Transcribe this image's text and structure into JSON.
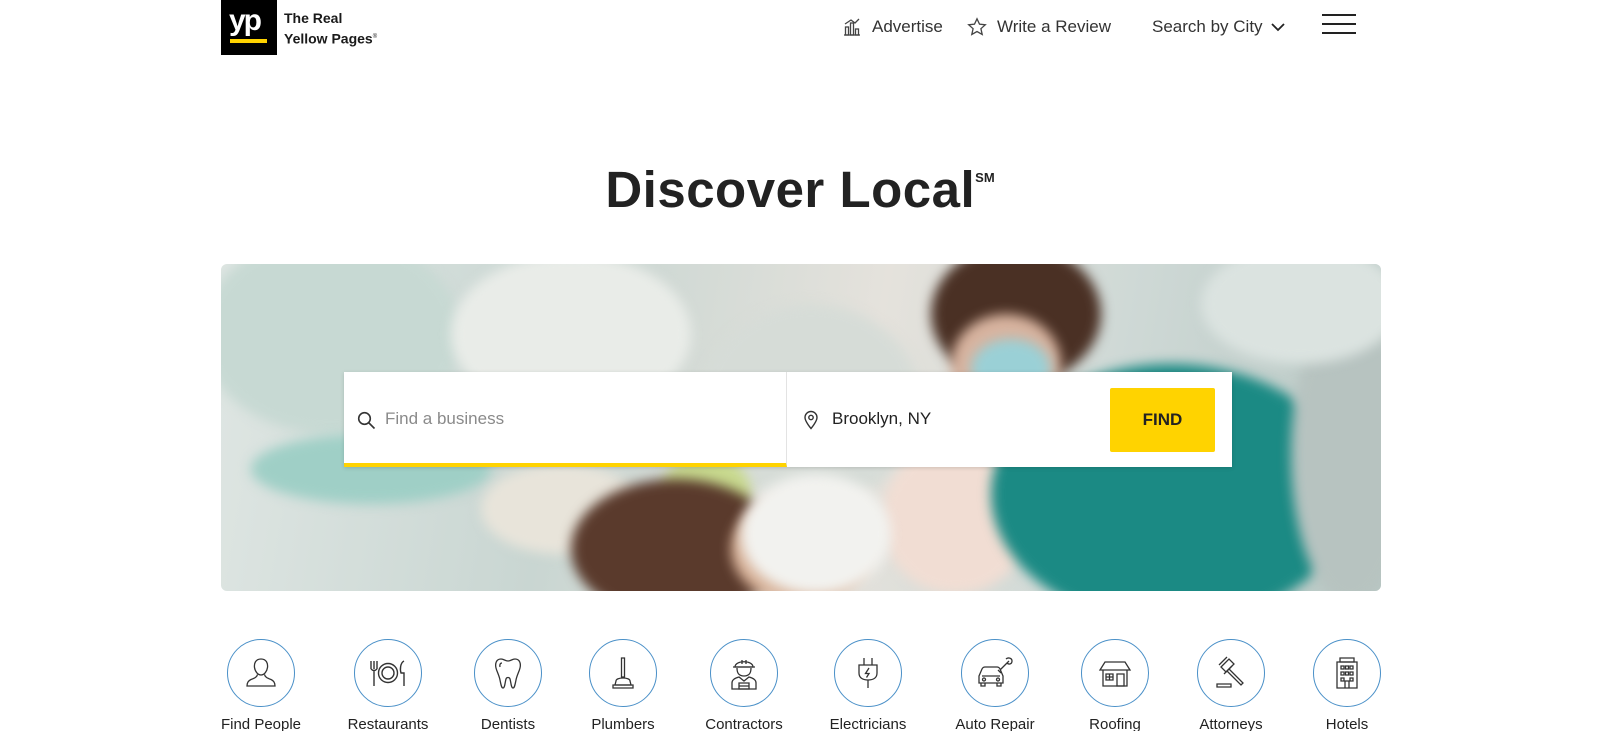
{
  "header": {
    "logo_text": "yp",
    "brand_line1": "The Real",
    "brand_line2": "Yellow Pages",
    "brand_mark": "®",
    "nav": {
      "advertise": "Advertise",
      "write_review": "Write a Review",
      "search_by_city": "Search by City"
    }
  },
  "hero": {
    "title": "Discover Local",
    "title_mark": "SM"
  },
  "search": {
    "what_placeholder": "Find a business",
    "where_value": "Brooklyn, NY",
    "find_label": "FIND"
  },
  "categories": [
    {
      "label": "Find People",
      "icon": "person-icon"
    },
    {
      "label": "Restaurants",
      "icon": "plate-utensils-icon"
    },
    {
      "label": "Dentists",
      "icon": "tooth-icon"
    },
    {
      "label": "Plumbers",
      "icon": "plunger-icon"
    },
    {
      "label": "Contractors",
      "icon": "worker-hardhat-icon"
    },
    {
      "label": "Electricians",
      "icon": "plug-icon"
    },
    {
      "label": "Auto Repair",
      "icon": "car-wrench-icon"
    },
    {
      "label": "Roofing",
      "icon": "house-roof-icon"
    },
    {
      "label": "Attorneys",
      "icon": "gavel-icon"
    },
    {
      "label": "Hotels",
      "icon": "hotel-building-icon"
    }
  ],
  "colors": {
    "brand_yellow": "#ffd300",
    "icon_ring_blue": "#4a90c8",
    "text_dark": "#222222"
  }
}
